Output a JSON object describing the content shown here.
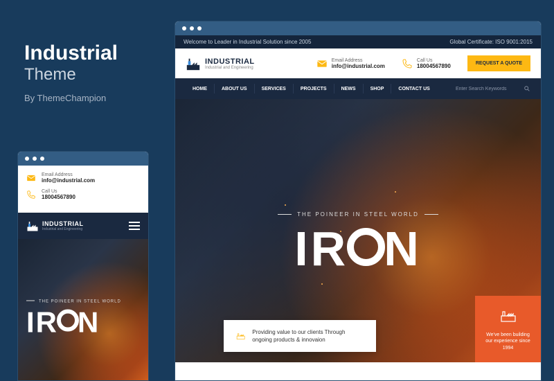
{
  "title": {
    "main": "Industrial",
    "sub": "Theme",
    "by": "By ThemeChampion"
  },
  "topbar": {
    "welcome": "Welcome to Leader in Industrial Solution since 2005",
    "cert": "Global Certificate: ISO 9001:2015"
  },
  "logo": {
    "name": "INDUSTRIAL",
    "tag": "Industrial and Engineering"
  },
  "contact": {
    "email": {
      "label": "Email Address",
      "value": "info@industrial.com"
    },
    "phone": {
      "label": "Call Us",
      "value": "18004567890"
    }
  },
  "cta": {
    "quote": "REQUEST A QUOTE"
  },
  "nav": {
    "items": [
      "HOME",
      "ABOUT US",
      "SERVICES",
      "PROJECTS",
      "NEWS",
      "SHOP",
      "CONTACT US"
    ]
  },
  "search": {
    "placeholder": "Enter Search Keywords"
  },
  "hero": {
    "tag": "THE POINEER IN STEEL WORLD",
    "title_pre": "IR",
    "title_post": "N"
  },
  "value_card": {
    "text": "Providing value to our clients Through ongoing products & innovaion"
  },
  "exp_card": {
    "text": "We've been building our experience since 1994"
  }
}
